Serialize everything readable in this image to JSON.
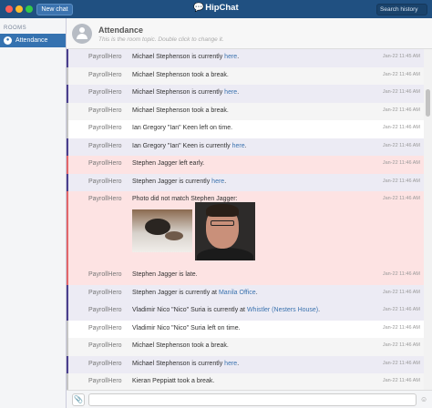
{
  "titlebar": {
    "new_chat_label": "New chat",
    "brand": "HipChat",
    "search_placeholder": "Search history"
  },
  "sidebar": {
    "heading": "ROOMS",
    "rooms": [
      {
        "label": "Attendance",
        "active": true
      }
    ]
  },
  "room": {
    "name": "Attendance",
    "topic": "This is the room topic. Double click to change it."
  },
  "messages": [
    {
      "sender": "PayrollHero",
      "pre": "Michael Stephenson is currently ",
      "link": "here",
      "post": ".",
      "time": "Jan-22 11:45 AM",
      "style": "purple"
    },
    {
      "sender": "PayrollHero",
      "pre": "Michael Stephenson took a break.",
      "link": "",
      "post": "",
      "time": "Jan-22 11:46 AM",
      "style": "plain"
    },
    {
      "sender": "PayrollHero",
      "pre": "Michael Stephenson is currently ",
      "link": "here",
      "post": ".",
      "time": "Jan-22 11:46 AM",
      "style": "purple"
    },
    {
      "sender": "PayrollHero",
      "pre": "Michael Stephenson took a break.",
      "link": "",
      "post": "",
      "time": "Jan-22 11:46 AM",
      "style": "plain"
    },
    {
      "sender": "PayrollHero",
      "pre": "Ian Gregory \"Ian\" Keen left on time.",
      "link": "",
      "post": "",
      "time": "Jan-22 11:46 AM",
      "style": "plain"
    },
    {
      "sender": "PayrollHero",
      "pre": "Ian Gregory \"Ian\" Keen is currently ",
      "link": "here",
      "post": ".",
      "time": "Jan-22 11:46 AM",
      "style": "purple"
    },
    {
      "sender": "PayrollHero",
      "pre": "Stephen Jagger left early.",
      "link": "",
      "post": "",
      "time": "Jan-22 11:46 AM",
      "style": "red"
    },
    {
      "sender": "PayrollHero",
      "pre": "Stephen Jagger is currently ",
      "link": "here",
      "post": ".",
      "time": "Jan-22 11:46 AM",
      "style": "purple"
    },
    {
      "sender": "PayrollHero",
      "pre": "Photo did not match Stephen Jagger:",
      "link": "",
      "post": "",
      "time": "Jan-22 11:46 AM",
      "style": "photo"
    },
    {
      "sender": "PayrollHero",
      "pre": "Stephen Jagger is late.",
      "link": "",
      "post": "",
      "time": "Jan-22 11:46 AM",
      "style": "red"
    },
    {
      "sender": "PayrollHero",
      "pre": "Stephen Jagger is currently at ",
      "link": "Manila Office",
      "post": ".",
      "time": "Jan-22 11:46 AM",
      "style": "purple"
    },
    {
      "sender": "PayrollHero",
      "pre": "Vladimir Nico \"Nico\" Suria is currently at ",
      "link": "Whistler (Nesters House)",
      "post": ".",
      "time": "Jan-22 11:46 AM",
      "style": "purple"
    },
    {
      "sender": "PayrollHero",
      "pre": "Vladimir Nico \"Nico\" Suria left on time.",
      "link": "",
      "post": "",
      "time": "Jan-22 11:46 AM",
      "style": "plain"
    },
    {
      "sender": "PayrollHero",
      "pre": "Michael Stephenson took a break.",
      "link": "",
      "post": "",
      "time": "Jan-22 11:46 AM",
      "style": "plain"
    },
    {
      "sender": "PayrollHero",
      "pre": "Michael Stephenson is currently ",
      "link": "here",
      "post": ".",
      "time": "Jan-22 11:46 AM",
      "style": "purple"
    },
    {
      "sender": "PayrollHero",
      "pre": "Kieran Peppiatt took a break.",
      "link": "",
      "post": "",
      "time": "Jan-22 11:46 AM",
      "style": "plain"
    }
  ],
  "composer": {
    "placeholder": ""
  },
  "colors": {
    "titlebar": "#205081",
    "accent": "#3572b0",
    "status_purple": "#4a3f8c",
    "status_red": "#e2666a",
    "link": "#3b73af"
  }
}
